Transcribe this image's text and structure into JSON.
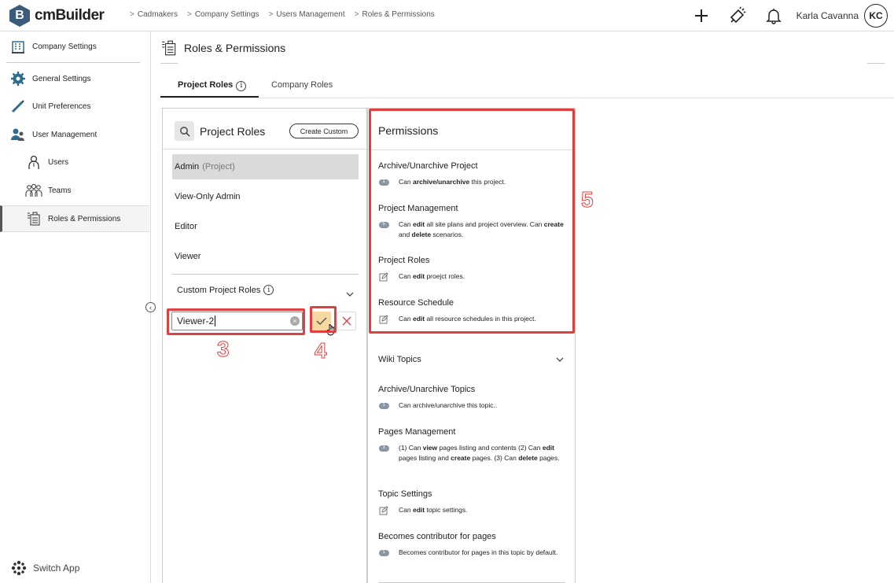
{
  "app": {
    "name": "cmBuilder",
    "logo_letter": "B"
  },
  "breadcrumb": [
    "Cadmakers",
    "Company Settings",
    "Users Management",
    "Roles & Permissions"
  ],
  "user": {
    "name": "Karla Cavanna",
    "initials": "KC"
  },
  "sidebar": {
    "header": "Company Settings",
    "items": [
      {
        "label": "General Settings",
        "icon": "gear-icon"
      },
      {
        "label": "Unit Preferences",
        "icon": "ruler-pencil-icon"
      },
      {
        "label": "User Management",
        "icon": "users-icon"
      },
      {
        "label": "Users",
        "icon": "user-icon"
      },
      {
        "label": "Teams",
        "icon": "team-icon"
      },
      {
        "label": "Roles & Permissions",
        "icon": "roles-icon",
        "active": true
      }
    ],
    "switch_app": "Switch App"
  },
  "page": {
    "title": "Roles & Permissions"
  },
  "tabs": [
    {
      "label": "Project Roles",
      "active": true
    },
    {
      "label": "Company Roles",
      "active": false
    }
  ],
  "roles_panel": {
    "title": "Project Roles",
    "create_button": "Create Custom",
    "roles": [
      {
        "name": "Admin",
        "suffix": "(Project)",
        "selected": true
      },
      {
        "name": "View-Only Admin"
      },
      {
        "name": "Editor"
      },
      {
        "name": "Viewer"
      }
    ],
    "custom_section": "Custom Project Roles",
    "new_role_value": "Viewer-2"
  },
  "permissions_panel": {
    "title": "Permissions",
    "groups": [
      {
        "name": "Archive/Unarchive Project",
        "marker": "1",
        "parts": [
          [
            "Can ",
            false
          ],
          [
            "archive/unarchive",
            true
          ],
          [
            " this project.",
            false
          ]
        ]
      },
      {
        "name": "Project Management",
        "marker": "5",
        "parts": [
          [
            "Can ",
            false
          ],
          [
            "edit",
            true
          ],
          [
            " all site plans and project overview. Can ",
            false
          ],
          [
            "create",
            true
          ],
          [
            " and ",
            false
          ],
          [
            "delete",
            true
          ],
          [
            " scenarios.",
            false
          ]
        ]
      },
      {
        "name": "Project Roles",
        "marker": "edit",
        "parts": [
          [
            "Can ",
            false
          ],
          [
            "edit",
            true
          ],
          [
            " proejct roles.",
            false
          ]
        ]
      },
      {
        "name": "Resource Schedule",
        "marker": "edit",
        "parts": [
          [
            "Can ",
            false
          ],
          [
            "edit",
            true
          ],
          [
            " all resource schedules in this project.",
            false
          ]
        ]
      }
    ],
    "wiki_section": "Wiki Topics",
    "wiki_groups": [
      {
        "name": "Archive/Unarchive Topics",
        "marker": "1",
        "parts": [
          [
            "Can archive/unarchive this topic..",
            false
          ]
        ]
      },
      {
        "name": "Pages Management",
        "marker": "3",
        "parts": [
          [
            "(1) Can ",
            false
          ],
          [
            "view",
            true
          ],
          [
            " pages listing and contents (2) Can ",
            false
          ],
          [
            "edit",
            true
          ],
          [
            " pages listing and ",
            false
          ],
          [
            "create",
            true
          ],
          [
            " pages. (3) Can ",
            false
          ],
          [
            "delete",
            true
          ],
          [
            " pages.",
            false
          ]
        ]
      },
      {
        "name": "Topic Settings",
        "marker": "edit",
        "parts": [
          [
            "Can ",
            false
          ],
          [
            "edit",
            true
          ],
          [
            " topic settings.",
            false
          ]
        ]
      },
      {
        "name": "Becomes contributor for pages",
        "marker": "1",
        "parts": [
          [
            "Becomes contributor for pages in this topic by default.",
            false
          ]
        ]
      }
    ]
  },
  "annotations": {
    "step3": "3",
    "step4": "4",
    "step5": "5",
    "highlight_color": "#e0403f"
  }
}
